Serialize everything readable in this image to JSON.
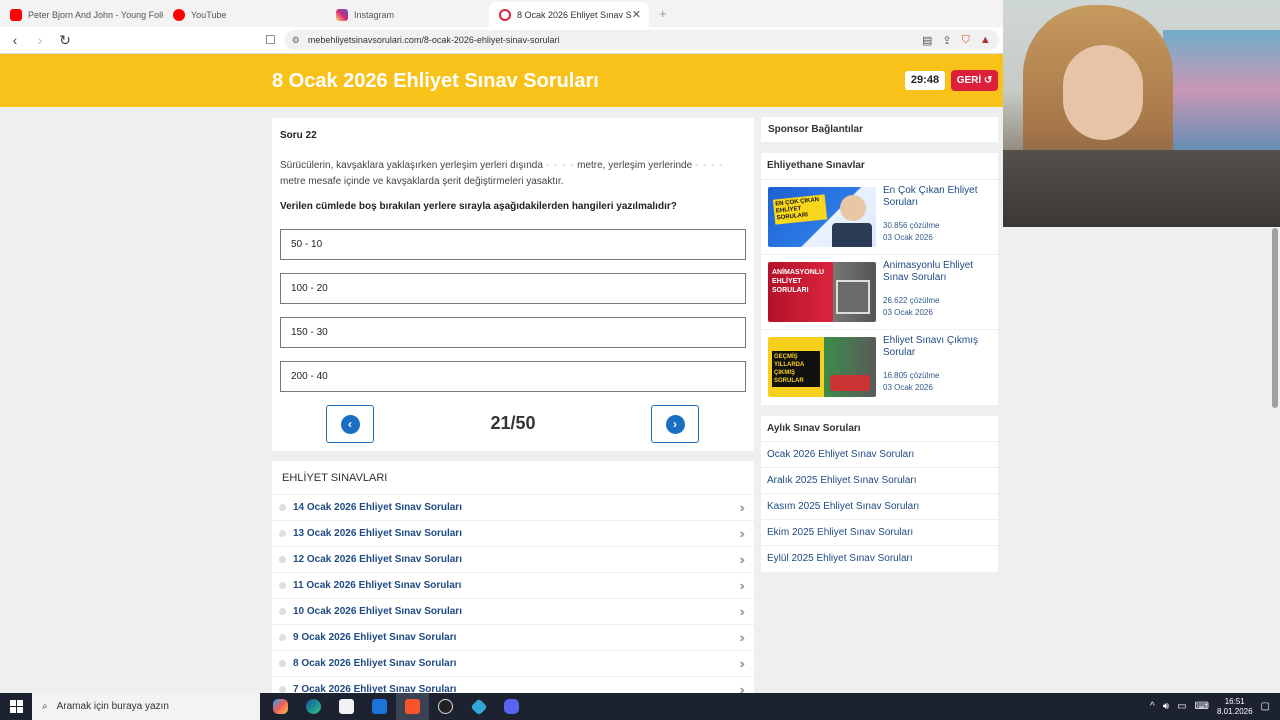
{
  "browser": {
    "tabs": [
      {
        "title": "Peter Bjorn And John - Young Folks",
        "color": "#ff0000",
        "active": false
      },
      {
        "title": "YouTube",
        "color": "#ff0000",
        "active": false
      },
      {
        "title": "Instagram",
        "color": "#d6249f",
        "active": false
      },
      {
        "title": "8 Ocak 2026 Ehliyet Sınav Soruları",
        "color": "#dc1f3b",
        "active": true
      }
    ],
    "new_tab": "+",
    "url": "mebehliyetsinavsorulari.com/8-ocak-2026-ehliyet-sinav-sorulari"
  },
  "header": {
    "title": "8 Ocak 2026 Ehliyet Sınav Soruları",
    "timer": "29:48",
    "back_label": "GERİ"
  },
  "question": {
    "number_label": "Soru 22",
    "text_part1": "Sürücülerin, kavşaklara yaklaşırken yerleşim yerleri dışında",
    "blank": "- - - -",
    "text_part2": "metre, yerleşim yerlerinde",
    "text_part3": "metre mesafe içinde ve kavşaklarda şerit değiştirmeleri yasaktır.",
    "prompt": "Verilen cümlede boş bırakılan yerlere sırayla aşağıdakilerden hangileri yazılmalıdır?",
    "options": [
      "50 - 10",
      "100 - 20",
      "150 - 30",
      "200 - 40"
    ],
    "page_counter": "21/50"
  },
  "exams": {
    "heading": "EHLİYET SINAVLARI",
    "items": [
      "14 Ocak 2026 Ehliyet Sınav Soruları",
      "13 Ocak 2026 Ehliyet Sınav Soruları",
      "12 Ocak 2026 Ehliyet Sınav Soruları",
      "11 Ocak 2026 Ehliyet Sınav Soruları",
      "10 Ocak 2026 Ehliyet Sınav Soruları",
      "9 Ocak 2026 Ehliyet Sınav Soruları",
      "8 Ocak 2026 Ehliyet Sınav Soruları",
      "7 Ocak 2026 Ehliyet Sınav Soruları"
    ]
  },
  "sidebar": {
    "sponsor": "Sponsor Bağlantılar",
    "ehliyethane_heading": "Ehliyethane Sınavlar",
    "ehliyethane_items": [
      {
        "title": "En Çok Çıkan Ehliyet Soruları",
        "count": "30.856 çözülme",
        "date": "03 Ocak 2026",
        "img_text": "EN ÇOK ÇIKAN EHLİYET SORULARI"
      },
      {
        "title": "Animasyonlu Ehliyet Sınav Soruları",
        "count": "26.622 çözülme",
        "date": "03 Ocak 2026",
        "img_text": "ANİMASYONLU EHLİYET SORULARI"
      },
      {
        "title": "Ehliyet Sınavı Çıkmış Sorular",
        "count": "16.805 çözülme",
        "date": "03 Ocak 2026",
        "img_text": "GEÇMİŞ YILLARDA ÇIKMIŞ SORULAR"
      }
    ],
    "monthly_heading": "Aylık Sınav Soruları",
    "monthly_items": [
      "Ocak 2026 Ehliyet Sınav Soruları",
      "Aralık 2025 Ehliyet Sınav Soruları",
      "Kasım 2025 Ehliyet Sınav Soruları",
      "Ekim 2025 Ehliyet Sınav Soruları",
      "Eylül 2025 Ehliyet Sınav Soruları"
    ]
  },
  "taskbar": {
    "search_placeholder": "Aramak için buraya yazın",
    "time": "16:51",
    "date": "8.01.2026"
  },
  "colors": {
    "header_yellow": "#f9c21a",
    "back_red": "#dc1f3b",
    "nav_blue": "#1b6fc2",
    "link_blue": "#1e4a85"
  }
}
